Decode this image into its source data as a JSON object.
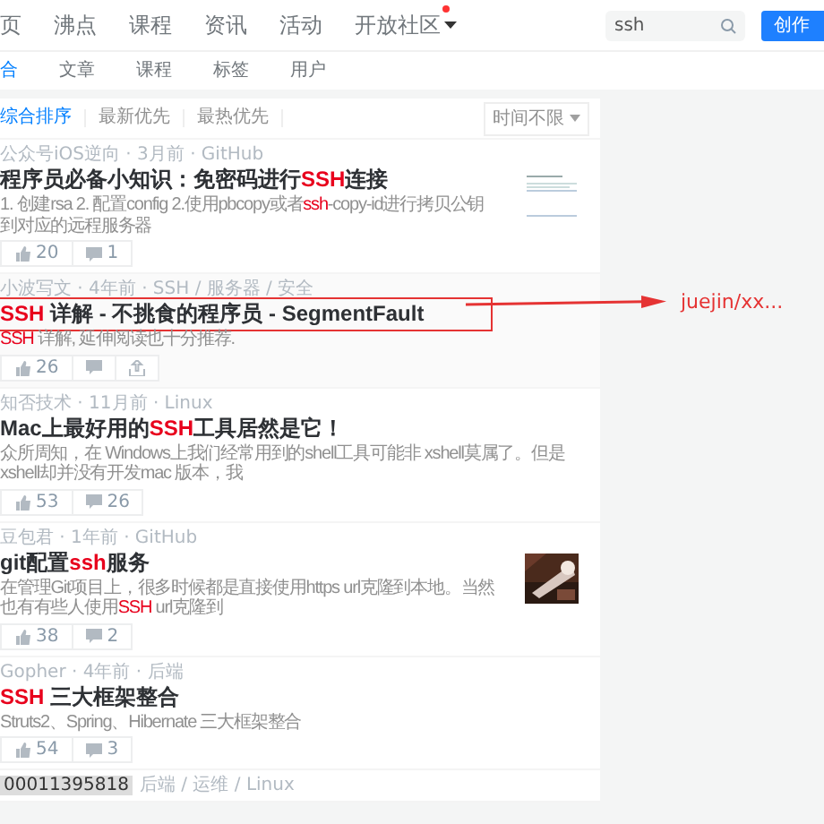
{
  "nav": {
    "items": [
      {
        "label": "页",
        "selected": false
      },
      {
        "label": "沸点",
        "selected": false
      },
      {
        "label": "课程",
        "selected": false
      },
      {
        "label": "资讯",
        "selected": false
      },
      {
        "label": "活动",
        "selected": false
      },
      {
        "label": "开放社区",
        "selected": false,
        "dropdown": true,
        "dot": true
      }
    ],
    "search": {
      "value": "ssh"
    },
    "button": "创作"
  },
  "tabs": [
    {
      "label": "合",
      "selected": true
    },
    {
      "label": "文章",
      "selected": false
    },
    {
      "label": "课程",
      "selected": false
    },
    {
      "label": "标签",
      "selected": false
    },
    {
      "label": "用户",
      "selected": false
    }
  ],
  "sort": {
    "options": [
      {
        "label": "综合排序",
        "selected": true
      },
      {
        "label": "最新优先",
        "selected": false
      },
      {
        "label": "最热优先",
        "selected": false
      }
    ],
    "time_filter": "时间不限"
  },
  "articles": [
    {
      "meta": "公众号iOS逆向 · 3月前 · GitHub",
      "title_parts": [
        {
          "text": "程序员必备小知识：免密码进行",
          "highlight": false
        },
        {
          "text": "SSH",
          "highlight": true
        },
        {
          "text": "连接",
          "highlight": false
        }
      ],
      "excerpt_parts": [
        {
          "text": "1. 创建rsa 2. 配置config 2.使用pbcopy或者",
          "highlight": false
        },
        {
          "text": "ssh",
          "highlight": true
        },
        {
          "text": "-copy-id进行拷贝公钥到对应的远程服务器",
          "highlight": false
        }
      ],
      "likes": "20",
      "comments": "1",
      "hovered": false,
      "outlined": false,
      "thumbnail": {
        "kind": "document"
      }
    },
    {
      "meta": "小波写文 · 4年前 · SSH / 服务器 / 安全",
      "title_parts": [
        {
          "text": "SSH",
          "highlight": true
        },
        {
          "text": " 详解 - 不挑食的程序员 - SegmentFault",
          "highlight": false
        }
      ],
      "excerpt_parts": [
        {
          "text": "SSH",
          "highlight": true
        },
        {
          "text": " 详解, 延伸阅读也十分推荐.",
          "highlight": false
        }
      ],
      "likes": "26",
      "hovered": true,
      "outlined": true
    },
    {
      "meta": "知否技术 · 11月前 · Linux",
      "title_parts": [
        {
          "text": "Mac上最好用的",
          "highlight": false
        },
        {
          "text": "SSH",
          "highlight": true
        },
        {
          "text": "工具居然是它！",
          "highlight": false
        }
      ],
      "excerpt_parts": [
        {
          "text": "众所周知，在 Windows上我们经常用到的shell工具可能非 xshell莫属了。但是xshell却并没有开发mac 版本，我",
          "highlight": false
        }
      ],
      "likes": "53",
      "comments": "26",
      "hovered": false,
      "outlined": false
    },
    {
      "meta": "豆包君 · 1年前 · GitHub",
      "title_parts": [
        {
          "text": "git配置",
          "highlight": false
        },
        {
          "text": "ssh",
          "highlight": true
        },
        {
          "text": "服务",
          "highlight": false
        }
      ],
      "excerpt_parts": [
        {
          "text": "在管理Git项目上，很多时候都是直接使用https url克隆到本地。当然也有有些人使用",
          "highlight": false
        },
        {
          "text": "SSH",
          "highlight": true
        },
        {
          "text": " url克隆到",
          "highlight": false
        }
      ],
      "likes": "38",
      "comments": "2",
      "hovered": false,
      "outlined": false
    },
    {
      "meta": "Gopher · 4年前 · 后端",
      "title_parts": [
        {
          "text": "SSH",
          "highlight": true
        },
        {
          "text": " 三大框架整合",
          "highlight": false
        }
      ],
      "excerpt_parts": [
        {
          "text": "Struts2、Spring、Hibernate 三大框架整合",
          "highlight": false
        }
      ],
      "likes": "54",
      "comments": "3",
      "hovered": false,
      "outlined": false
    },
    {
      "meta": "后端 / 运维 / Linux",
      "tooltip": "00011395818"
    }
  ],
  "annotation": {
    "text": "juejin/xx..."
  }
}
